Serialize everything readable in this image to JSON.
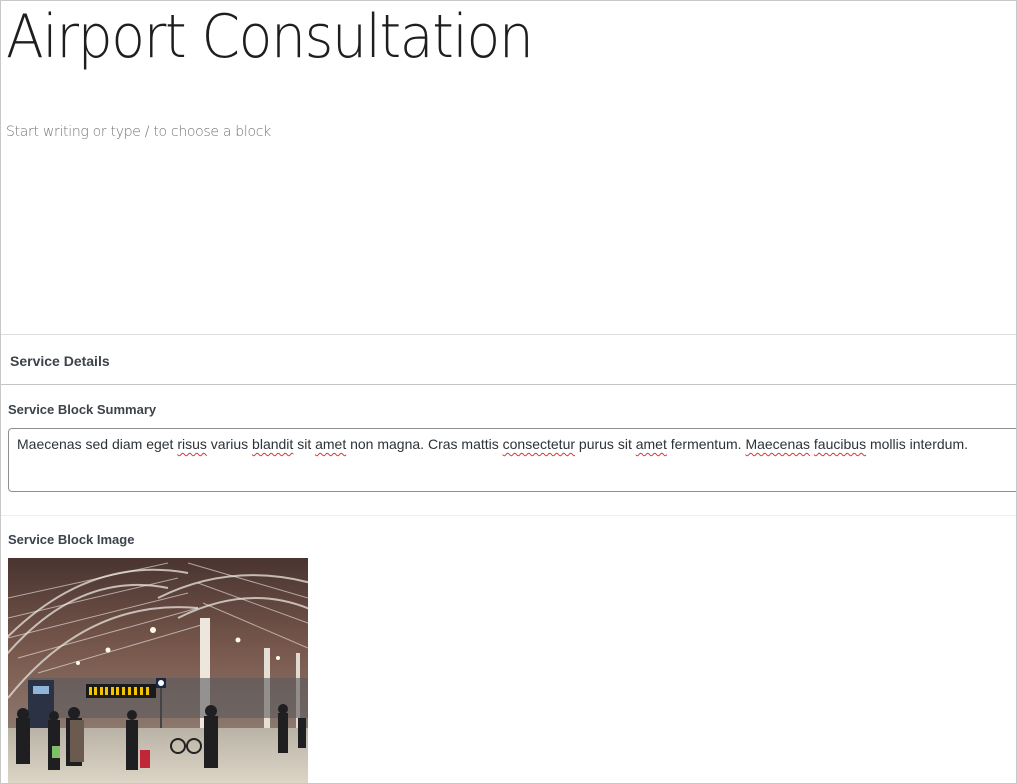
{
  "post": {
    "title": "Airport Consultation",
    "block_placeholder": "Start writing or type / to choose a block"
  },
  "meta_box": {
    "title": "Service Details",
    "fields": {
      "summary": {
        "label": "Service Block Summary",
        "value": "Maecenas sed diam eget risus varius blandit sit amet non magna. Cras mattis consectetur purus sit amet fermentum. Maecenas faucibus mollis interdum."
      },
      "image": {
        "label": "Service Block Image",
        "icon": "train-station-photo"
      }
    }
  },
  "colors": {
    "label": "#3c434a",
    "placeholder": "#757575",
    "border": "#8c8f94",
    "spellcheck": "#d63638"
  }
}
